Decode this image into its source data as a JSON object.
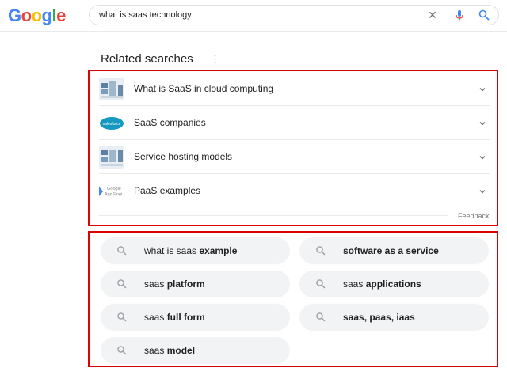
{
  "header": {
    "logo_letters": [
      {
        "ch": "G",
        "color": "#4285F4"
      },
      {
        "ch": "o",
        "color": "#EA4335"
      },
      {
        "ch": "o",
        "color": "#FBBC05"
      },
      {
        "ch": "g",
        "color": "#4285F4"
      },
      {
        "ch": "l",
        "color": "#34A853"
      },
      {
        "ch": "e",
        "color": "#EA4335"
      }
    ],
    "search_value": "what is saas technology"
  },
  "related": {
    "title": "Related searches",
    "questions": [
      {
        "label": "What is SaaS in cloud computing",
        "thumb": "diagram"
      },
      {
        "label": "SaaS companies",
        "thumb": "salesforce"
      },
      {
        "label": "Service hosting models",
        "thumb": "diagram"
      },
      {
        "label": "PaaS examples",
        "thumb": "appengine"
      }
    ],
    "thumb_text": {
      "salesforce": "salesforce",
      "appengine_1": "Google",
      "appengine_2": "App Engi"
    },
    "feedback": "Feedback"
  },
  "chips": [
    {
      "plain": "what is saas ",
      "bold": "example"
    },
    {
      "plain": "",
      "bold": "software as a service"
    },
    {
      "plain": "saas ",
      "bold": "platform"
    },
    {
      "plain": "saas ",
      "bold": "applications"
    },
    {
      "plain": "saas ",
      "bold": "full form"
    },
    {
      "plain": "",
      "bold": "saas, paas, iaas"
    },
    {
      "plain": "saas ",
      "bold": "model"
    }
  ],
  "colors": {
    "highlight_border": "#e00000",
    "chip_bg": "#f1f3f4",
    "mic_blue": "#4285F4",
    "mic_red": "#EA4335"
  }
}
